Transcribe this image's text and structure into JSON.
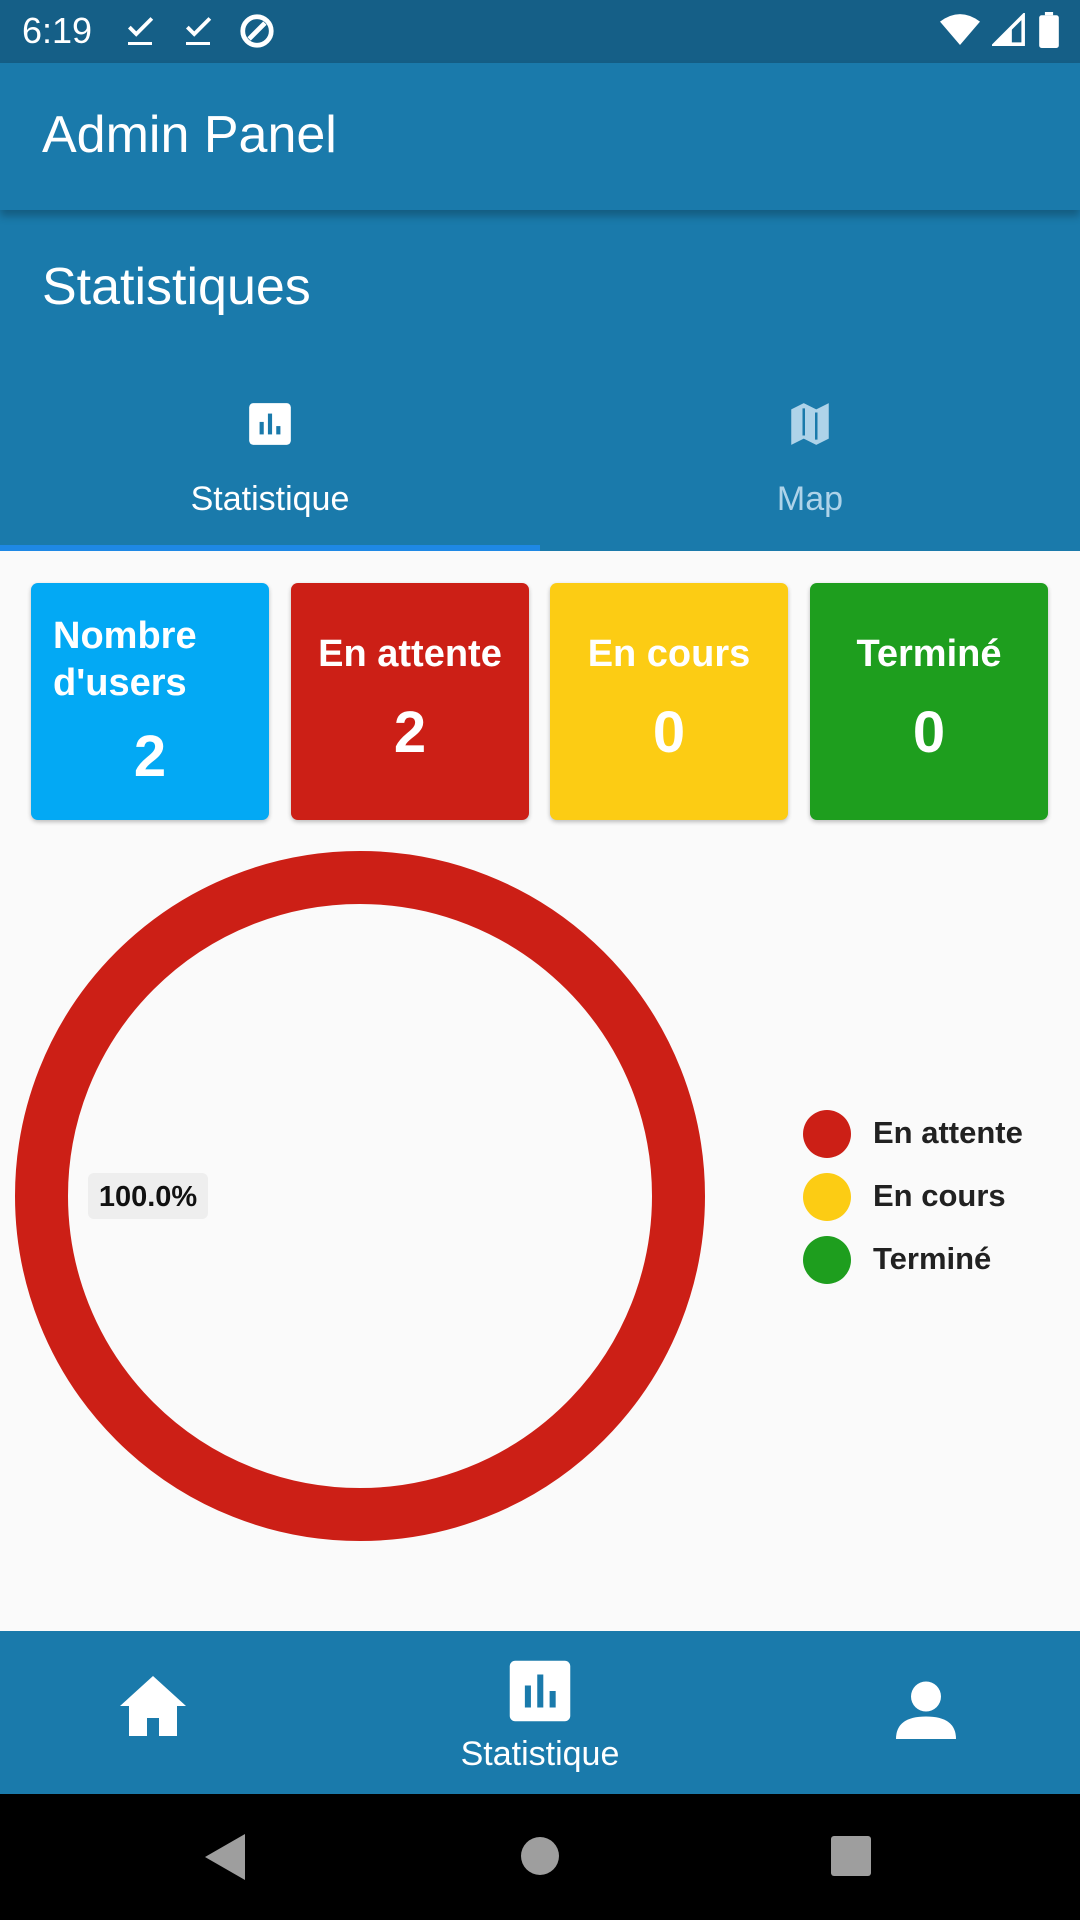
{
  "status_bar": {
    "time": "6:19",
    "left_icons": [
      "download-done-icon",
      "download-done-icon",
      "data-saver-icon"
    ],
    "right_icons": [
      "wifi-icon",
      "signal-icon",
      "battery-icon"
    ]
  },
  "appbar": {
    "title": "Admin Panel"
  },
  "header": {
    "section_title": "Statistiques"
  },
  "tabs": [
    {
      "label": "Statistique",
      "icon": "bar-chart-icon",
      "active": true
    },
    {
      "label": "Map",
      "icon": "map-icon",
      "active": false
    }
  ],
  "cards": [
    {
      "title": "Nombre d'users",
      "value": "2",
      "color": "#03a9f4"
    },
    {
      "title": "En attente",
      "value": "2",
      "color": "#cc1f16"
    },
    {
      "title": "En cours",
      "value": "0",
      "color": "#fccc14"
    },
    {
      "title": "Terminé",
      "value": "0",
      "color": "#1e9e1e"
    }
  ],
  "chart_data": {
    "type": "pie",
    "style": "donut",
    "categories": [
      "En attente",
      "En cours",
      "Terminé"
    ],
    "values": [
      2,
      0,
      0
    ],
    "colors": [
      "#cc1f16",
      "#fccc14",
      "#1e9e1e"
    ],
    "data_labels": [
      "100.0%"
    ],
    "legend": "right"
  },
  "bottom_nav": {
    "items": [
      {
        "icon": "home-icon",
        "label": ""
      },
      {
        "icon": "bar-chart-icon",
        "label": "Statistique",
        "active": true
      },
      {
        "icon": "person-icon",
        "label": ""
      }
    ]
  },
  "system_nav": [
    "back-icon",
    "home-circle-icon",
    "recents-icon"
  ]
}
